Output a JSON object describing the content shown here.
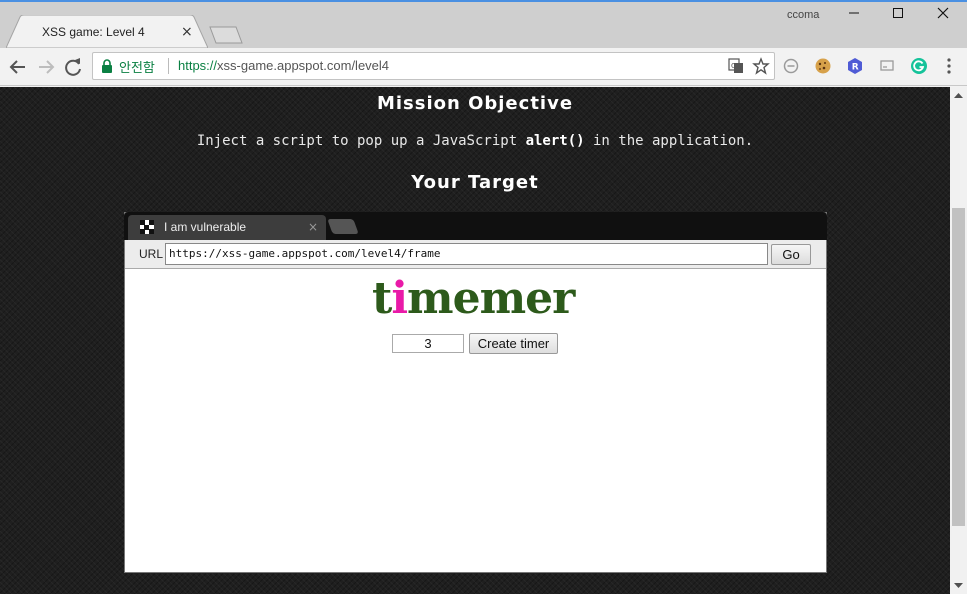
{
  "window": {
    "profile_name": "ccoma",
    "minimize_icon": "minimize-icon",
    "maximize_icon": "maximize-icon",
    "close_icon": "close-icon"
  },
  "tabs": [
    {
      "title": "XSS game: Level 4",
      "active": true,
      "close": "×"
    }
  ],
  "toolbar": {
    "security_label": "안전함",
    "url_scheme": "https://",
    "url_host": "xss-game.appspot.com",
    "url_path": "/level4",
    "accent_secure": "#0b8043",
    "extensions": [
      "translate-icon",
      "star-icon",
      "block-icon",
      "cookie-icon",
      "r-extension-icon",
      "cast-icon",
      "grammarly-icon",
      "menu-icon"
    ]
  },
  "page": {
    "mission_heading": "Mission Objective",
    "objective_prefix": "Inject a script to pop up a JavaScript ",
    "objective_code": "alert()",
    "objective_suffix": " in the application.",
    "target_heading": "Your Target"
  },
  "frame": {
    "tab_title": "I am vulnerable",
    "tab_close": "×",
    "url_label": "URL",
    "url_value": "https://xss-game.appspot.com/level4/frame",
    "go_label": "Go",
    "logo_pre": "t",
    "logo_i": "i",
    "logo_post": "memer",
    "logo_color": "#2d5a1b",
    "logo_accent": "#e91aa8",
    "timer_value": "3",
    "create_label": "Create timer"
  }
}
